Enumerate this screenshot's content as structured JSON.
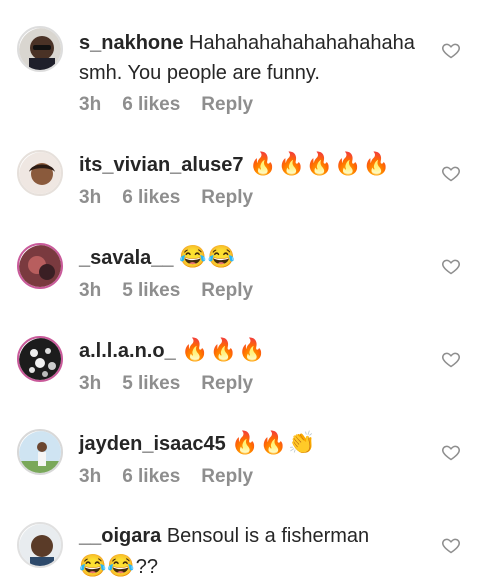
{
  "comments": [
    {
      "username": "s_nakhone",
      "text": "Hahahahahahahahahaha smh. You people are funny.",
      "emoji": "",
      "suffix": "",
      "time": "3h",
      "likes": "6 likes",
      "reply": "Reply"
    },
    {
      "username": "its_vivian_aluse7",
      "text": "",
      "emoji": "🔥🔥🔥🔥🔥",
      "suffix": "",
      "time": "3h",
      "likes": "6 likes",
      "reply": "Reply"
    },
    {
      "username": "_savala__",
      "text": "",
      "emoji": "😂😂",
      "suffix": "",
      "time": "3h",
      "likes": "5 likes",
      "reply": "Reply"
    },
    {
      "username": "a.l.l.a.n.o_",
      "text": "",
      "emoji": "🔥🔥🔥",
      "suffix": "",
      "time": "3h",
      "likes": "5 likes",
      "reply": "Reply"
    },
    {
      "username": "jayden_isaac45",
      "text": "",
      "emoji": "🔥🔥👏",
      "suffix": "",
      "time": "3h",
      "likes": "6 likes",
      "reply": "Reply"
    },
    {
      "username": "__oigara",
      "text": "Bensoul is a fisherman",
      "emoji": "😂😂",
      "suffix": "??",
      "time": "",
      "likes": "",
      "reply": ""
    }
  ],
  "icons": {
    "like": "heart-outline-icon"
  },
  "colors": {
    "text": "#262626",
    "meta": "#8e8e8e",
    "background": "#ffffff"
  }
}
